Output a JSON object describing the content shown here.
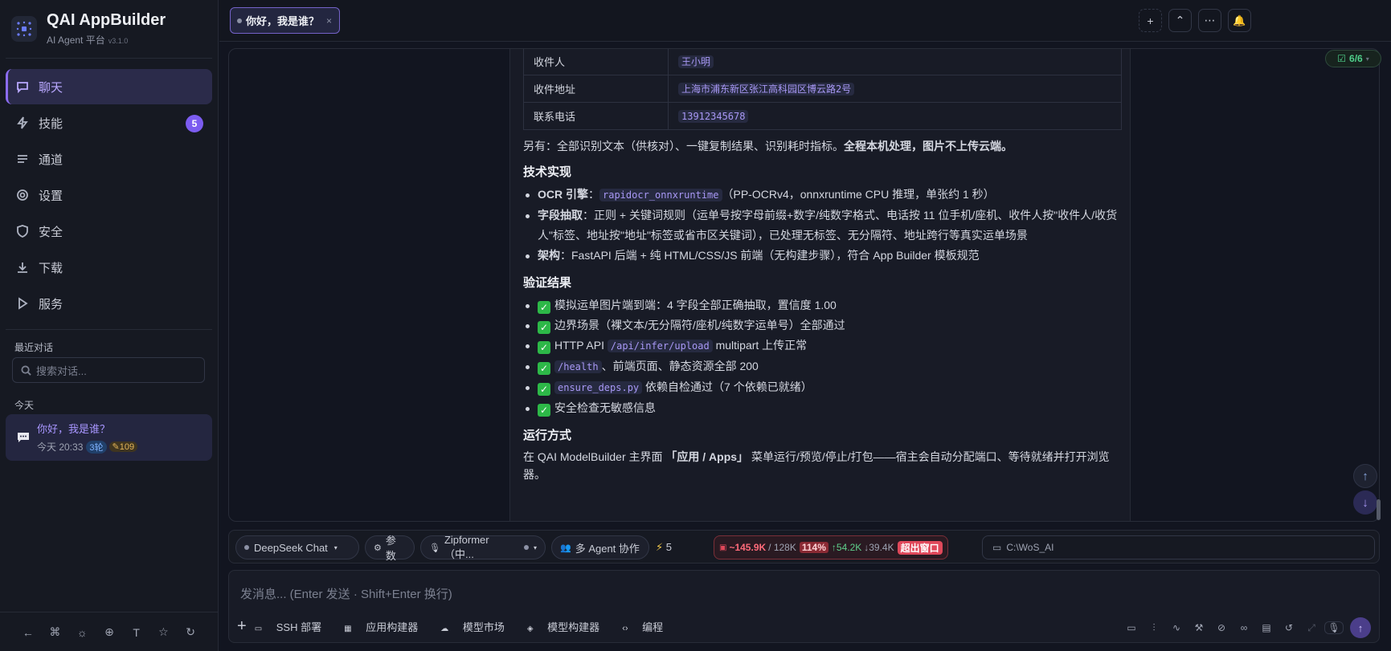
{
  "app": {
    "title": "QAI AppBuilder",
    "subtitle": "AI Agent 平台",
    "version": "v3.1.0"
  },
  "nav": [
    {
      "label": "聊天",
      "icon": "chat-icon"
    },
    {
      "label": "技能",
      "icon": "bolt-icon",
      "badge": "5"
    },
    {
      "label": "通道",
      "icon": "list-icon"
    },
    {
      "label": "设置",
      "icon": "gear-icon"
    },
    {
      "label": "安全",
      "icon": "shield-icon"
    },
    {
      "label": "下载",
      "icon": "download-icon"
    },
    {
      "label": "服务",
      "icon": "play-icon"
    }
  ],
  "sidebar": {
    "recent_label": "最近对话",
    "search_placeholder": "搜索对话...",
    "group_today": "今天",
    "conversation": {
      "title": "你好，我是谁？",
      "time": "今天 20:33",
      "rounds": "3轮",
      "tokens": "109"
    }
  },
  "tab": {
    "title": "你好，我是谁？",
    "close": "×"
  },
  "topbar": {
    "add": "+",
    "collapse": "⌃",
    "more": "⋯",
    "bell": "🔔"
  },
  "message": {
    "table": [
      {
        "key": "收件人",
        "value": "王小明"
      },
      {
        "key": "收件地址",
        "value": "上海市浦东新区张江高科园区博云路2号"
      },
      {
        "key": "联系电话",
        "value": "13912345678"
      }
    ],
    "note_prefix": "另有：全部识别文本（供核对）、一键复制结果、识别耗时指标。",
    "note_bold": "全程本机处理，图片不上传云端。",
    "tech_heading": "技术实现",
    "tech": [
      {
        "label": "OCR 引擎",
        "sep": "：",
        "code": "rapidocr_onnxruntime",
        "rest": "（PP-OCRv4，onnxruntime CPU 推理，单张约 1 秒）"
      },
      {
        "label": "字段抽取",
        "sep": "：",
        "rest": "正则 + 关键词规则（运单号按字母前缀+数字/纯数字格式、电话按 11 位手机/座机、收件人按\"收件人/收货人\"标签、地址按\"地址\"标签或省市区关键词），已处理无标签、无分隔符、地址跨行等真实运单场景"
      },
      {
        "label": "架构",
        "sep": "：",
        "rest": "FastAPI 后端 + 纯 HTML/CSS/JS 前端（无构建步骤），符合 App Builder 模板规范"
      }
    ],
    "verify_heading": "验证结果",
    "verify": [
      {
        "pre": "模拟运单图片端到端：4 字段全部正确抽取，置信度 1.00"
      },
      {
        "pre": "边界场景（裸文本/无分隔符/座机/纯数字运单号）全部通过"
      },
      {
        "pre": "HTTP API ",
        "code": "/api/infer/upload",
        "post": " multipart 上传正常"
      },
      {
        "pre": "",
        "code": "/health",
        "post": "、前端页面、静态资源全部 200"
      },
      {
        "pre": "",
        "code": "ensure_deps.py",
        "post": " 依赖自检通过（7 个依赖已就绪）"
      },
      {
        "pre": "安全检查无敏感信息"
      }
    ],
    "run_heading": "运行方式",
    "run_pre": "在 QAI ModelBuilder 主界面 ",
    "run_bold": "「应用 / Apps」",
    "run_post": " 菜单运行/预览/停止/打包——宿主会自动分配端口、等待就绪并打开浏览器。"
  },
  "counter": "6/6",
  "toolbar": {
    "model": "DeepSeek Chat",
    "params": "参数",
    "asr": "Zipformer（中...",
    "agents": "多 Agent 协作",
    "bolt_count": "5",
    "tokens_used": "~145.9K",
    "tokens_limit": "/ 128K",
    "percent": "114%",
    "up": "↑54.2K",
    "down": "↓39.4K",
    "overflow": "超出窗口",
    "path": "C:\\WoS_AI"
  },
  "composer": {
    "placeholder": "发消息... (Enter 发送 · Shift+Enter 换行)",
    "tools": [
      "SSH 部署",
      "应用构建器",
      "模型市场",
      "模型构建器",
      "编程"
    ]
  },
  "colors": {
    "accent": "#8b6cf2",
    "bg": "#121520",
    "ok": "#2db848",
    "danger": "#e0485a"
  }
}
